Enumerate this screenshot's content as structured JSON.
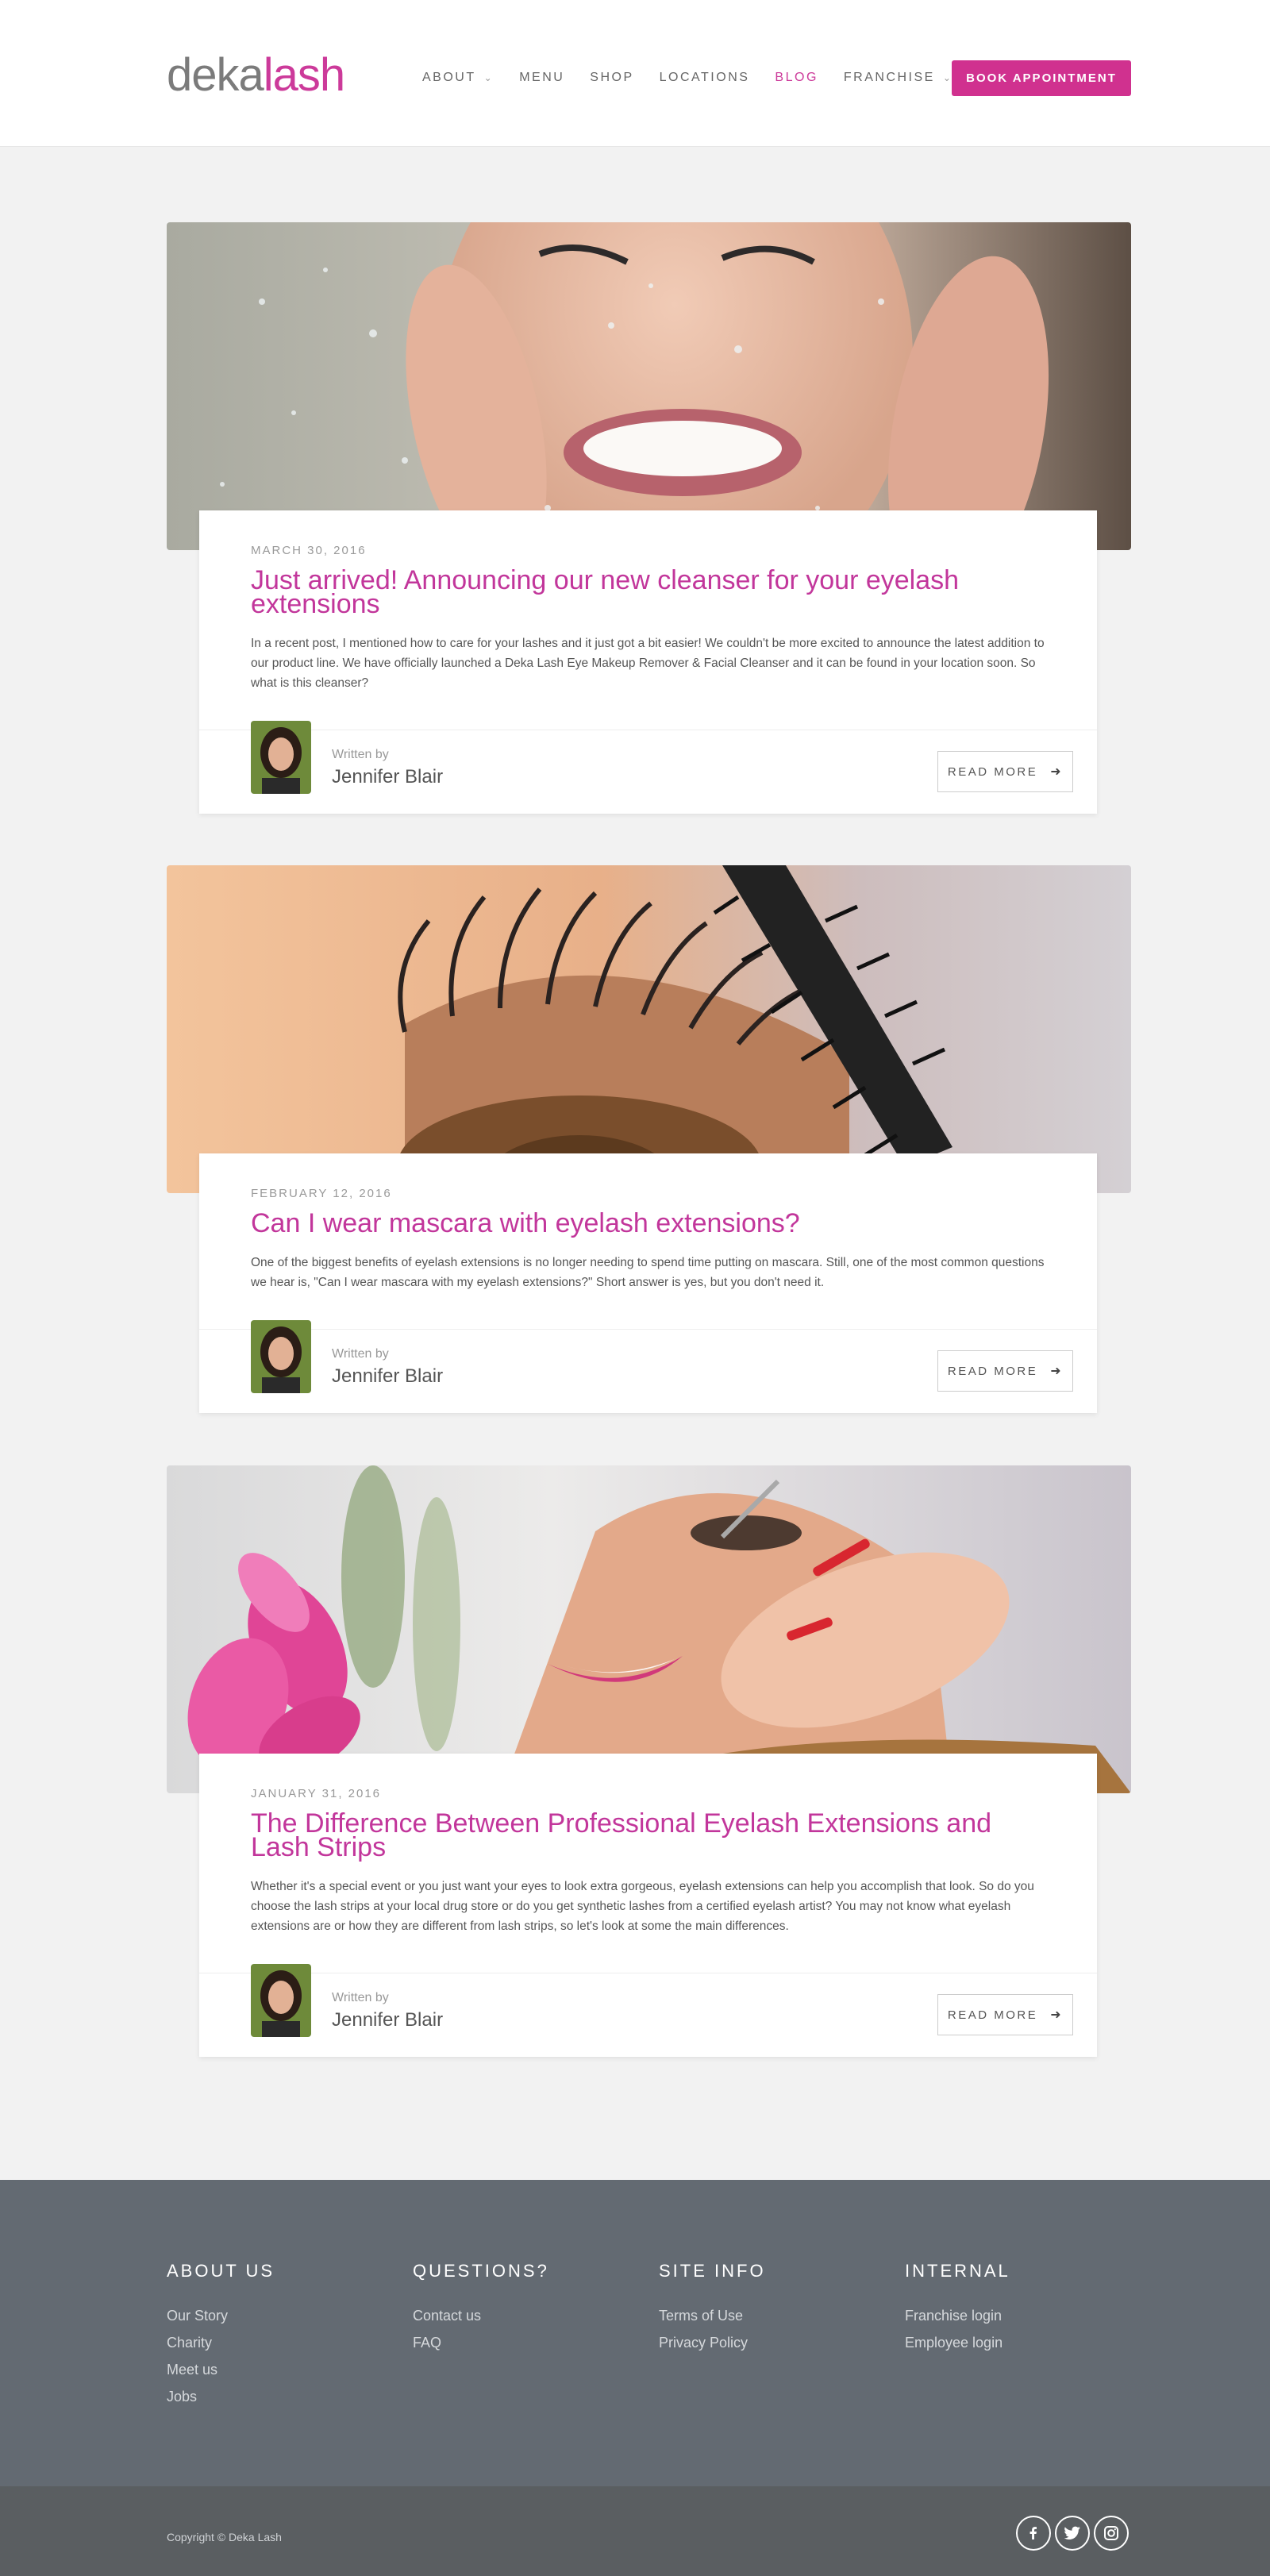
{
  "header": {
    "logo_part1": "deka",
    "logo_part2": "lash",
    "nav": [
      {
        "label": "ABOUT",
        "has_dropdown": true
      },
      {
        "label": "MENU",
        "has_dropdown": false
      },
      {
        "label": "SHOP",
        "has_dropdown": false
      },
      {
        "label": "LOCATIONS",
        "has_dropdown": false
      },
      {
        "label": "BLOG",
        "has_dropdown": false,
        "active": true
      },
      {
        "label": "FRANCHISE",
        "has_dropdown": true
      }
    ],
    "book_label": "BOOK APPOINTMENT"
  },
  "posts": [
    {
      "date": "MARCH 30, 2016",
      "title": "Just arrived! Announcing our new cleanser for your eyelash extensions",
      "excerpt": "In a recent post, I mentioned how to care for your lashes and it just got a bit easier! We couldn't be more excited to announce the latest addition to our product line. We have officially launched a Deka Lash Eye Makeup Remover & Facial Cleanser and it can be found in your location soon.  So what is this cleanser?",
      "written_by": "Written by",
      "author": "Jennifer Blair",
      "read_more": "READ MORE"
    },
    {
      "date": "FEBRUARY 12, 2016",
      "title": "Can I wear mascara with eyelash extensions?",
      "excerpt": "One of the biggest benefits of eyelash extensions is no longer needing to spend time putting on mascara. Still, one of the most common questions we hear is, \"Can I wear mascara with my eyelash extensions?\" Short answer is yes, but you don't need it.",
      "written_by": "Written by",
      "author": "Jennifer Blair",
      "read_more": "READ MORE"
    },
    {
      "date": "JANUARY 31, 2016",
      "title": "The Difference Between Professional Eyelash Extensions and Lash Strips",
      "excerpt": "Whether it's a special event or you just want your eyes to look extra gorgeous, eyelash extensions can help you accomplish that look.  So do you choose the lash strips at your local drug store or do you get synthetic lashes from a certified eyelash artist? You may not know what eyelash extensions are or how they are different from lash strips, so let's look at some the main differences.",
      "written_by": "Written by",
      "author": "Jennifer Blair",
      "read_more": "READ MORE"
    }
  ],
  "footer": {
    "columns": [
      {
        "heading": "ABOUT US",
        "links": [
          "Our Story",
          "Charity",
          "Meet us",
          "Jobs"
        ]
      },
      {
        "heading": "QUESTIONS?",
        "links": [
          "Contact us",
          "FAQ"
        ]
      },
      {
        "heading": "SITE INFO",
        "links": [
          "Terms of Use",
          "Privacy Policy"
        ]
      },
      {
        "heading": "INTERNAL",
        "links": [
          "Franchise login",
          "Employee login"
        ]
      }
    ],
    "copyright": "Copyright © Deka Lash",
    "social": [
      "facebook-icon",
      "twitter-icon",
      "instagram-icon"
    ]
  },
  "colors": {
    "brand": "#cc3a9a",
    "button": "#d0318f",
    "footer": "#636a72",
    "subfooter": "#5a5e61"
  }
}
